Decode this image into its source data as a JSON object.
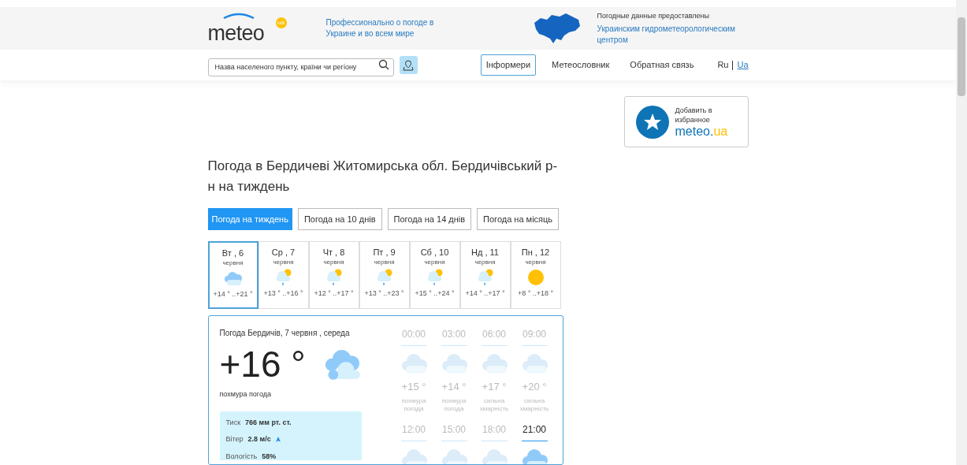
{
  "header": {
    "logo": {
      "text": "meteo",
      "badge": "ua"
    },
    "tagline": "Профессионально о погоде в Украине и во всем мире",
    "provider_label": "Погодные данные предоставлены",
    "provider_name": "Украинским гидрометеорологическим центром"
  },
  "nav": {
    "search": {
      "placeholder": "Назва населеного пункту, країни чи регіону"
    },
    "links": [
      {
        "label": "Інформери",
        "selected": true
      },
      {
        "label": "Метеословник",
        "selected": false
      },
      {
        "label": "Обратная связь",
        "selected": false
      }
    ],
    "languages": [
      {
        "label": "Ru",
        "selected": false
      },
      {
        "label": "Ua",
        "selected": true
      }
    ]
  },
  "favorite": {
    "text": "Добавить в избранное",
    "brand": "meteo.",
    "brand_accent": "ua"
  },
  "title": "Погода в Бердичеві Житомирська обл. Бердичівський р-н на тиждень",
  "tabs": [
    {
      "label": "Погода на тиждень",
      "selected": true
    },
    {
      "label": "Погода на 10 днів",
      "selected": false
    },
    {
      "label": "Погода на 14 днів",
      "selected": false
    },
    {
      "label": "Погода на місяць",
      "selected": false
    }
  ],
  "days": [
    {
      "day": "Вт , 6",
      "month": "червня",
      "kind": "cloudy",
      "temps": "+14 ° ..+21 °",
      "selected": true
    },
    {
      "day": "Ср , 7",
      "month": "червня",
      "kind": "rain-sun",
      "temps": "+13 ° ..+16 °",
      "selected": false
    },
    {
      "day": "Чт , 8",
      "month": "червня",
      "kind": "rain-sun",
      "temps": "+12 ° ..+17 °",
      "selected": false
    },
    {
      "day": "Пт , 9",
      "month": "червня",
      "kind": "rain-sun",
      "temps": "+13 ° ..+23 °",
      "selected": false
    },
    {
      "day": "Сб , 10",
      "month": "червня",
      "kind": "rain-sun",
      "temps": "+15 ° ..+24 °",
      "selected": false
    },
    {
      "day": "Нд , 11",
      "month": "червня",
      "kind": "rain-sun",
      "temps": "+14 ° ..+17 °",
      "selected": false
    },
    {
      "day": "Пн , 12",
      "month": "червня",
      "kind": "sun",
      "temps": "+8 ° ..+18 °",
      "selected": false
    }
  ],
  "current": {
    "heading": "Погода Бердичів, 7 червня , середа",
    "temperature": "+16 °",
    "condition": "похмура погода",
    "details": [
      {
        "label": "Тиск",
        "value": "766 мм рт. ст."
      },
      {
        "label": "Вітер",
        "value": "2.8 м/с",
        "kind": "wind"
      },
      {
        "label": "Вологість",
        "value": "58%"
      }
    ]
  },
  "hours": [
    {
      "time": "00:00",
      "temp": "+15 °",
      "condition": "похмура погода",
      "selected": false
    },
    {
      "time": "03:00",
      "temp": "+14 °",
      "condition": "похмура погода",
      "selected": false
    },
    {
      "time": "06:00",
      "temp": "+17 °",
      "condition": "сильна хмарність",
      "selected": false
    },
    {
      "time": "09:00",
      "temp": "+20 °",
      "condition": "сильна хмарність",
      "selected": false
    },
    {
      "time": "12:00",
      "selected": false
    },
    {
      "time": "15:00",
      "selected": false
    },
    {
      "time": "18:00",
      "selected": false
    },
    {
      "time": "21:00",
      "selected": true
    }
  ]
}
